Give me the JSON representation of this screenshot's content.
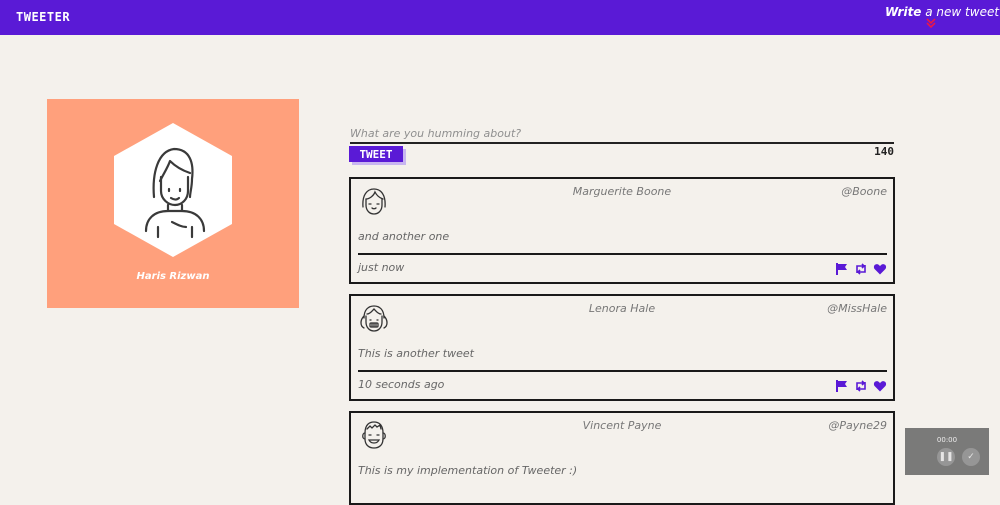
{
  "nav": {
    "brand": "TWEETER",
    "write_bold": "Write",
    "write_rest": " a new tweet"
  },
  "profile": {
    "name": "Haris Rizwan",
    "bg_color": "#ffa07c"
  },
  "composer": {
    "placeholder": "What are you humming about?",
    "button_label": "TWEET",
    "counter": "140"
  },
  "tweets": [
    {
      "author": "Marguerite Boone",
      "handle": "@Boone",
      "text": "and another one",
      "time": "just now"
    },
    {
      "author": "Lenora Hale",
      "handle": "@MissHale",
      "text": "This is another tweet",
      "time": "10 seconds ago"
    },
    {
      "author": "Vincent Payne",
      "handle": "@Payne29",
      "text": "This is my implementation of Tweeter :)",
      "time": ""
    }
  ],
  "recorder": {
    "time": "00:00",
    "icons": [
      "pause-icon",
      "check-icon"
    ]
  },
  "colors": {
    "accent": "#5a1ad6",
    "heart": "#e8174a",
    "background": "#f4f1ec"
  }
}
